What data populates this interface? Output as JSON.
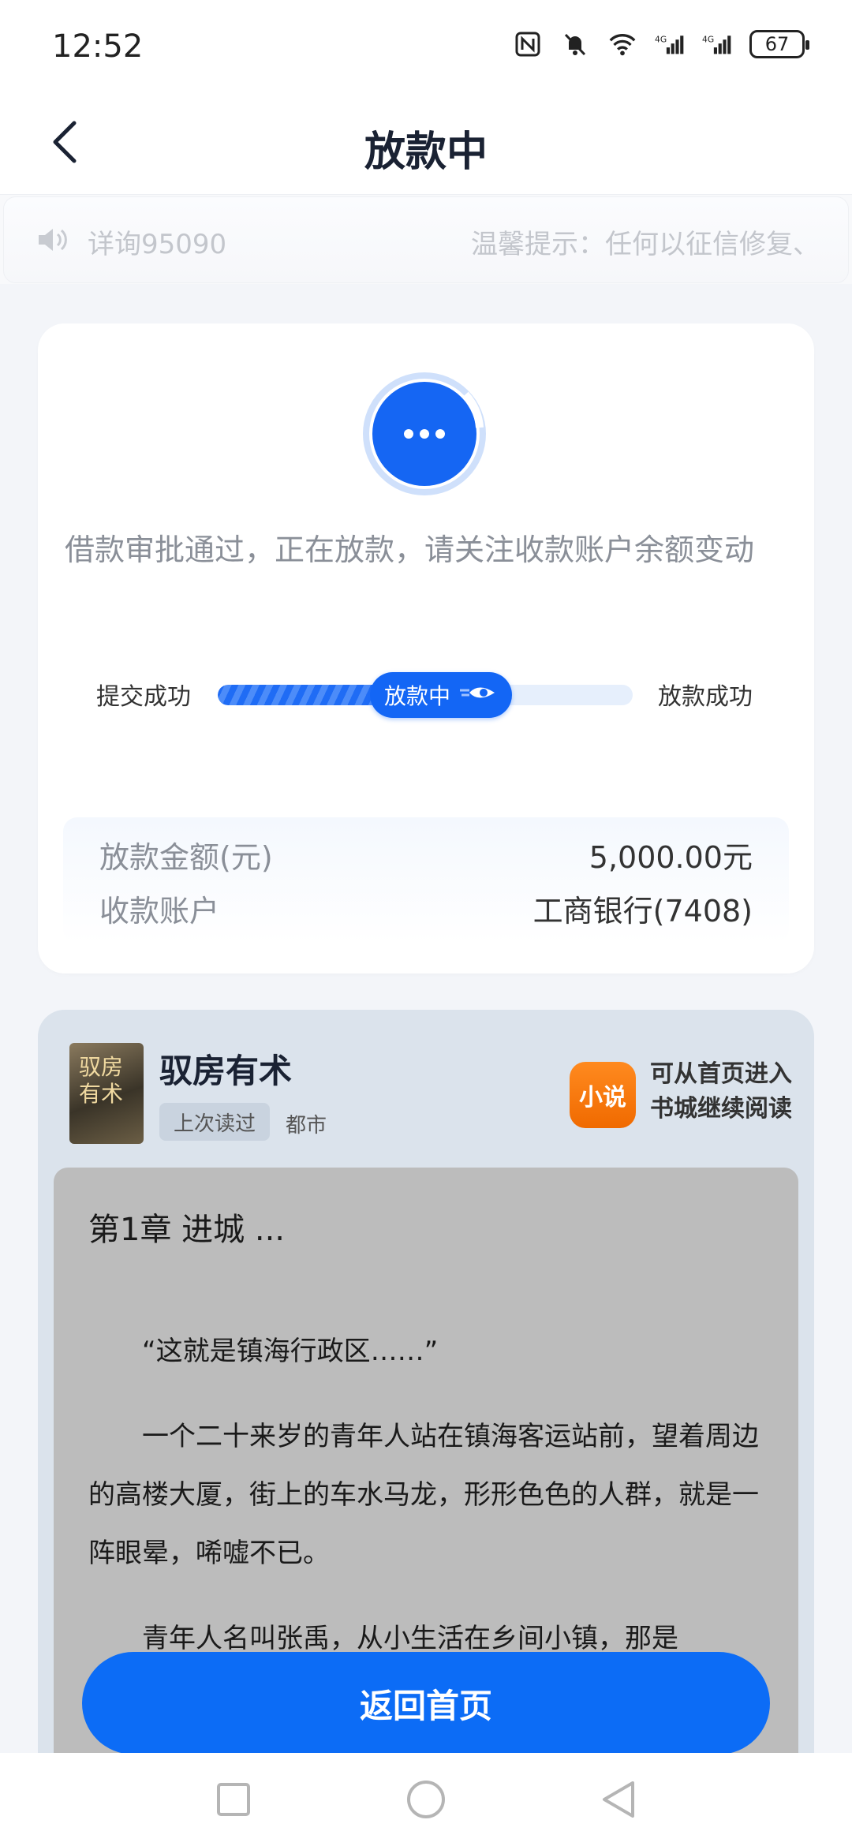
{
  "status_bar": {
    "time": "12:52",
    "battery": "67",
    "icons": [
      "nfc-icon",
      "mute-icon",
      "wifi-icon",
      "signal-4g-icon",
      "signal-4g-icon",
      "battery-icon"
    ]
  },
  "nav": {
    "title": "放款中",
    "back_icon": "back-arrow-icon"
  },
  "notice": {
    "hotline": "详询95090",
    "tip": "温馨提示：任何以征信修复、"
  },
  "status": {
    "message": "借款审批通过，正在放款，请关注收款账户余额变动",
    "progress": {
      "start_label": "提交成功",
      "current_label": "放款中",
      "end_label": "放款成功",
      "fraction": 0.5
    },
    "info": [
      {
        "label": "放款金额(元)",
        "value": "5,000.00元"
      },
      {
        "label": "收款账户",
        "value": "工商银行(7408)"
      }
    ]
  },
  "book": {
    "cover_text": "驭房有术",
    "title": "驭房有术",
    "tag": "上次读过",
    "genre": "都市",
    "app_logo_text": "小说",
    "app_hint": "可从首页进入书城继续阅读",
    "chapter_title": "第1章 进城 ...",
    "paragraphs": [
      "“这就是镇海行政区……”",
      "一个二十来岁的青年人站在镇海客运站前，望着周边的高楼大厦，街上的车水马龙，形形色色的人群，就是一阵眼晕，唏嘘不已。",
      "青年人名叫张禹，从小生活在乡间小镇，那是"
    ]
  },
  "button": {
    "home": "返回首页"
  },
  "colors": {
    "primary": "#0c6cf6",
    "app_logo": "#f37a0c"
  }
}
